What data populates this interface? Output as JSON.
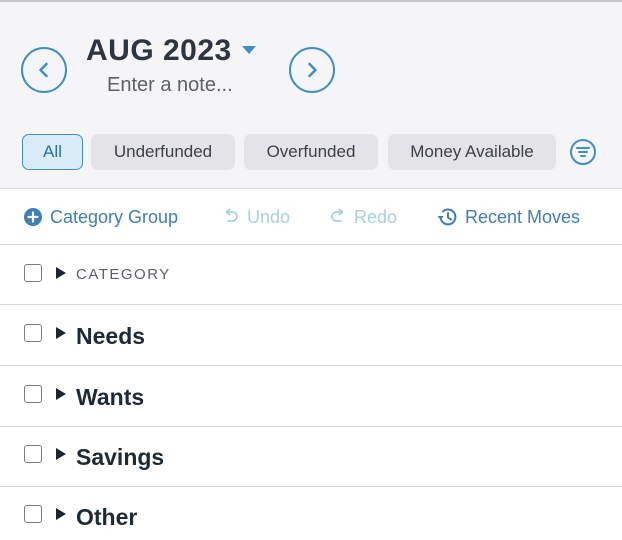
{
  "header": {
    "month": "AUG 2023",
    "note_placeholder": "Enter a note..."
  },
  "filters": {
    "chips": [
      {
        "label": "All",
        "active": true
      },
      {
        "label": "Underfunded",
        "active": false
      },
      {
        "label": "Overfunded",
        "active": false
      },
      {
        "label": "Money Available",
        "active": false
      }
    ]
  },
  "toolbar": {
    "category_group": "Category Group",
    "undo": "Undo",
    "redo": "Redo",
    "recent_moves": "Recent Moves"
  },
  "table": {
    "column_header": "CATEGORY",
    "groups": [
      {
        "name": "Needs"
      },
      {
        "name": "Wants"
      },
      {
        "name": "Savings"
      },
      {
        "name": "Other"
      }
    ]
  },
  "colors": {
    "accent": "#3e8fc4",
    "accent_text": "#3e7fb8",
    "disabled": "#a9cfe3",
    "header_bg": "#f5f5f8",
    "chip_bg": "#e4e4e8",
    "chip_active_bg": "#d8ecf8"
  },
  "icons": {
    "prev": "chevron-left-circle-icon",
    "next": "chevron-right-circle-icon",
    "month_menu": "caret-down-icon",
    "filter": "filter-lines-icon",
    "add": "plus-circle-icon",
    "undo": "undo-icon",
    "redo": "redo-icon",
    "history": "history-icon",
    "expand": "triangle-right-icon"
  }
}
